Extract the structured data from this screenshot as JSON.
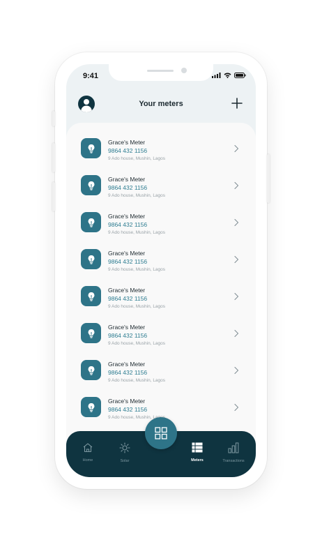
{
  "status": {
    "time": "9:41"
  },
  "header": {
    "title": "Your meters"
  },
  "meters": [
    {
      "name": "Grace's Meter",
      "number": "9864 432 1156",
      "address": "9 Ado house, Mushin, Lagos"
    },
    {
      "name": "Grace's Meter",
      "number": "9864 432 1156",
      "address": "9 Ado house, Mushin, Lagos"
    },
    {
      "name": "Grace's Meter",
      "number": "9864 432 1156",
      "address": "9 Ado house, Mushin, Lagos"
    },
    {
      "name": "Grace's Meter",
      "number": "9864 432 1156",
      "address": "9 Ado house, Mushin, Lagos"
    },
    {
      "name": "Grace's Meter",
      "number": "9864 432 1156",
      "address": "9 Ado house, Mushin, Lagos"
    },
    {
      "name": "Grace's Meter",
      "number": "9864 432 1156",
      "address": "9 Ado house, Mushin, Lagos"
    },
    {
      "name": "Grace's Meter",
      "number": "9864 432 1156",
      "address": "9 Ado house, Mushin, Lagos"
    },
    {
      "name": "Grace's Meter",
      "number": "9864 432 1156",
      "address": "9 Ado house, Mushin, Lagos"
    }
  ],
  "nav": {
    "items": [
      {
        "label": "Home",
        "icon": "home-icon"
      },
      {
        "label": "Solar",
        "icon": "sun-icon"
      },
      {
        "label": "Meters",
        "icon": "list-icon",
        "active": true
      },
      {
        "label": "Transactions",
        "icon": "bar-chart-icon"
      }
    ],
    "center_icon": "grid-icon"
  },
  "colors": {
    "primary": "#0f3440",
    "accent": "#2e7488",
    "number": "#2e7d91"
  }
}
